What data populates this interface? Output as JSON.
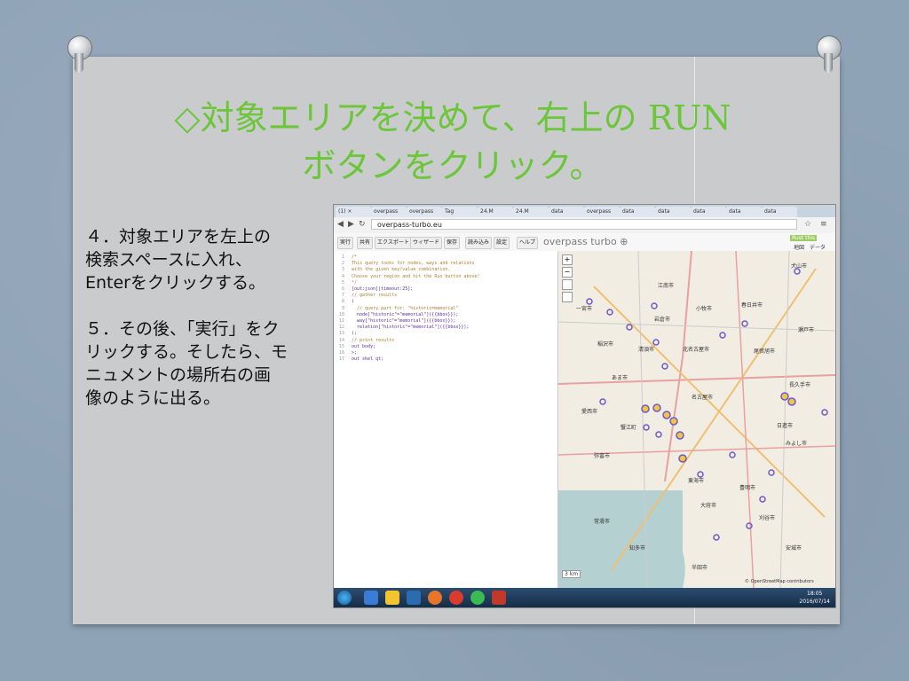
{
  "slide": {
    "title": "◇対象エリアを決めて、右上の RUN\nボタンをクリック。",
    "paragraphs": [
      "４．対象エリアを左上の\n検索スペースに入れ、\nEnterをクリックする。",
      "５．その後、「実行」をク\nリックする。そしたら、モ\nニュメントの場所右の画\n像のように出る。"
    ]
  },
  "browser": {
    "address": "overpass-turbo.eu",
    "tabs": [
      "(1) ×",
      "overpass",
      "overpass",
      "Tag",
      "24.M",
      "24.M",
      "data",
      "overpass",
      "data",
      "data",
      "data",
      "data",
      "data"
    ],
    "menu": [
      "実行",
      "共有",
      "エクスポート",
      "ウィザード",
      "保存",
      "読み込み",
      "設定",
      "ヘルプ"
    ],
    "brand": "overpass turbo ⊕",
    "right_buttons": [
      "Rust this",
      "地図",
      "データ"
    ]
  },
  "editor": {
    "lines": [
      {
        "n": "1",
        "t": "/*",
        "k": "comment"
      },
      {
        "n": "2",
        "t": "This query looks for nodes, ways and relations",
        "k": "comment"
      },
      {
        "n": "3",
        "t": "with the given key/value combination.",
        "k": "comment"
      },
      {
        "n": "4",
        "t": "Choose your region and hit the Run button above!",
        "k": "comment"
      },
      {
        "n": "5",
        "t": "*/",
        "k": "comment"
      },
      {
        "n": "6",
        "t": "[out:json][timeout:25];",
        "k": "code"
      },
      {
        "n": "7",
        "t": "// gather results",
        "k": "comment"
      },
      {
        "n": "8",
        "t": "(",
        "k": "code"
      },
      {
        "n": "9",
        "t": "  // query part for: \"historic=memorial\"",
        "k": "comment"
      },
      {
        "n": "10",
        "t": "  node[\"historic\"=\"memorial\"]({{bbox}});",
        "k": "code"
      },
      {
        "n": "11",
        "t": "  way[\"historic\"=\"memorial\"]({{bbox}});",
        "k": "code"
      },
      {
        "n": "12",
        "t": "  relation[\"historic\"=\"memorial\"]({{bbox}});",
        "k": "code"
      },
      {
        "n": "13",
        "t": ");",
        "k": "code"
      },
      {
        "n": "14",
        "t": "// print results",
        "k": "comment"
      },
      {
        "n": "15",
        "t": "out body;",
        "k": "code"
      },
      {
        "n": "16",
        "t": ">;",
        "k": "code"
      },
      {
        "n": "17",
        "t": "out skel qt;",
        "k": "code"
      }
    ]
  },
  "map": {
    "labels": [
      "犬山市",
      "江南市",
      "岩倉市",
      "稲沢市",
      "春日井市",
      "小牧市",
      "清須市",
      "北名古屋市",
      "あま市",
      "愛西市",
      "名古屋市",
      "弥富市",
      "蟹江町",
      "東海市",
      "大府市",
      "刈谷市",
      "知多市",
      "半田市",
      "日進市",
      "みよし市",
      "豊明市",
      "長久手市",
      "尾張旭市",
      "瀬戸市",
      "安城市",
      "一宮市",
      "常滑市"
    ],
    "scale": "3 km",
    "attribution": "© OpenStreetMap contributors"
  },
  "taskbar": {
    "clock": "18:05\n2016/07/14"
  },
  "colors": {
    "title": "#6cc63a",
    "map_marker": "#f5c542",
    "road": "#e9a0a0"
  }
}
